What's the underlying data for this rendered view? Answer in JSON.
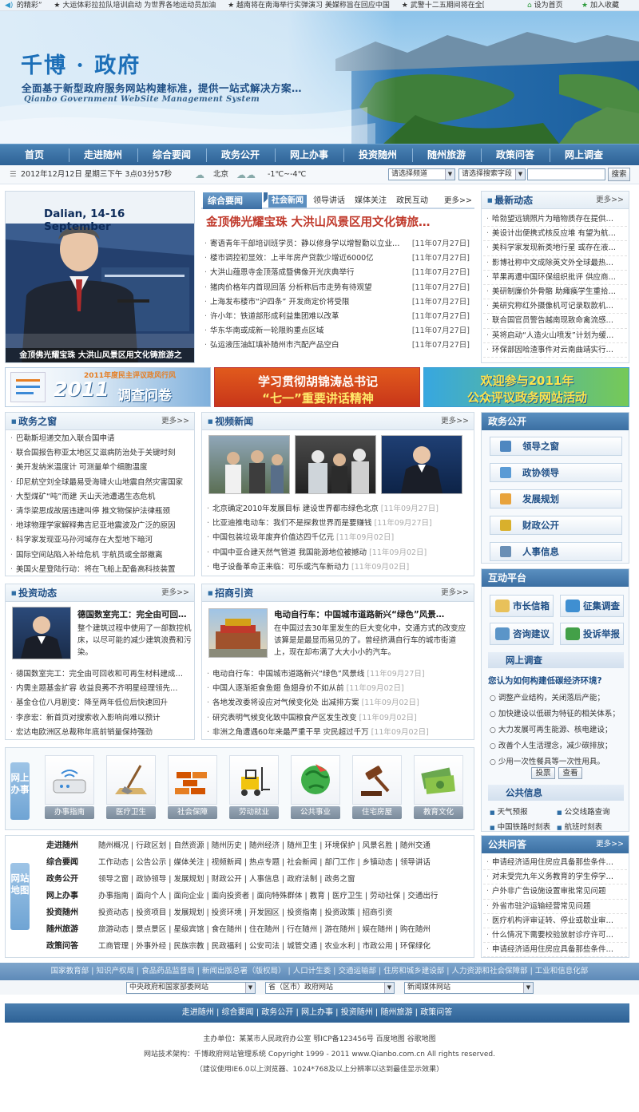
{
  "ticker": {
    "items": [
      "的精彩”",
      "★ 大运体彩拉拉队培训启动 为世界各地运动员加油",
      "★ 越南将在南海举行实弹演习 美媒称旨在回应中国",
      "★ 武警十二五期间将在全国"
    ],
    "home_label": "设为首页",
    "fav_label": "加入收藏"
  },
  "banner": {
    "title": "千博 · 政府",
    "slogan": "全面基于新型政府服务网站构建标准，提供一站式解决方案…",
    "english": "Qianbo Government WebSite Management System"
  },
  "nav": [
    "首页",
    "走进随州",
    "综合要闻",
    "政务公开",
    "网上办事",
    "投资随州",
    "随州旅游",
    "政策问答",
    "网上调查"
  ],
  "datebar": {
    "datetime": "2012年12月12日 星期三下午 3点03分57秒",
    "city": "北京",
    "temp": "-1℃~-4℃",
    "channel_select": "请选择频道",
    "field_select": "请选择搜索字段",
    "search_button": "搜索"
  },
  "photo": {
    "overlay_text": "Dalian, 14-16 September",
    "caption": "金顶佛光耀宝珠 大洪山风景区用文化铸旅游之"
  },
  "news": {
    "tabs": [
      "综合要闻",
      "社会新闻",
      "领导讲话",
      "媒体关注",
      "政民互动"
    ],
    "more": "更多>>",
    "headline": "金顶佛光耀宝珠 大洪山风景区用文化铸旅…",
    "items": [
      {
        "title": "寄语青年干部培训班学员：静以修身学以增智勤以立业…",
        "date": "[11年07月27日]"
      },
      {
        "title": "楼市调控初显效：上半年房产贷款少增近6000亿",
        "date": "[11年07月27日]"
      },
      {
        "title": "大洪山蕴恩寺金顶落成暨佛像开光庆典举行",
        "date": "[11年07月27日]"
      },
      {
        "title": "猪肉价格年内首现回落 分析称后市走势有待观望",
        "date": "[11年07月27日]"
      },
      {
        "title": "上海发布楼市“沪四条” 开发商定价将受限",
        "date": "[11年07月27日]"
      },
      {
        "title": "许小年：铁道部形成利益集团难以改革",
        "date": "[11年07月27日]"
      },
      {
        "title": "华东华南或成新一轮限购重点区域",
        "date": "[11年07月27日]"
      },
      {
        "title": "弘运液压油缸填补随州市汽配产品空白",
        "date": "[11年07月27日]"
      }
    ]
  },
  "latest": {
    "title": "最新动态",
    "more": "更多>>",
    "items": [
      "哈勃望远镜照片为暗物质存在提供…",
      "美设计出便携式核反应堆 有望为航…",
      "美科学家发现新类地行星 或存在液…",
      "影博社称中文成除英文外全球最热…",
      "苹果再遭中国环保组织批评 供应商…",
      "美研制廉价外骨骼 助瘫痪学生重拾…",
      "美研究称红外摄像机可记录取款机…",
      "联合国官员警告越南现致命禽流感…",
      "英将启动“人造火山喷发”计划为缓…",
      "环保部因哈渣事件对云南曲靖实行…"
    ]
  },
  "ad_banners": [
    {
      "tag": "2011年度民主评议政风行风",
      "year": "2011",
      "label": "调查问卷"
    },
    {
      "line1": "学习贯彻胡锦涛总书记",
      "line2": "“七一”重要讲话精神"
    },
    {
      "line1": "欢迎参与2011年",
      "line2": "公众评议政务网站活动"
    }
  ],
  "gov_window": {
    "title": "政务之窗",
    "more": "更多>>",
    "items": [
      "巴勒斯坦递交加入联合国申请",
      "联合国报告称亚太地区艾滋病防治处于关键时刻",
      "美开发纳米温度计 可测量单个细胞温度",
      "印尼航空刘全球最易受海啸火山地震自然灾害国家",
      "大型煤矿“吨”而建 天山天池遭遇生态危机",
      "清华梁思成故居违建叫停 推文物保护法律瓶颈",
      "地球物理学家解释弗吉尼亚地震波及广泛的原因",
      "科学家发现亚马孙河域存在大型地下暗河",
      "国际空间站陷入补给危机 宇航员或全部撤离",
      "美国火星登陆行动：将在飞船上配备高科技装置"
    ]
  },
  "video_news": {
    "title": "视频新闻",
    "more": "更多>>",
    "items": [
      {
        "title": "北京确定2010年发展目标 建设世界都市绿色北京",
        "date": "[11年09月27日]"
      },
      {
        "title": "比亚迪推电动车：我们不是探救世界而是要赚钱",
        "date": "[11年09月27日]"
      },
      {
        "title": "中国包装垃圾年废弃价值达四千亿元",
        "date": "[11年09月02日]"
      },
      {
        "title": "中国中亚合建天然气管道 我国能源地位被撼动",
        "date": "[11年09月02日]"
      },
      {
        "title": "电子设备革命正来临：可乐或汽车新动力",
        "date": "[11年09月02日]"
      }
    ]
  },
  "gov_open": {
    "title": "政务公开",
    "buttons": [
      "领导之窗",
      "政协领导",
      "发展规划",
      "财政公开",
      "人事信息"
    ]
  },
  "invest": {
    "title": "投资动态",
    "more": "更多>>",
    "feature_title": "德国数室完工：完全由可回…",
    "feature_text": "整个建筑过程中使用了一部数控机床，以尽可能的减少建筑浪费和污染。",
    "items": [
      "德国数室完工：完全由可回收和可再生材料建成…",
      "内需主题基金扩容 收益良莠不齐明星经理领先…",
      "基金仓位八月剧变：降至两年低位后快速回升",
      "李彦宏：新首页对搜索收入影响尚难以预计",
      "宏达电欧洲区总裁称年底前销量保持强劲"
    ]
  },
  "invite": {
    "title": "招商引资",
    "more": "更多>>",
    "feature_title": "电动自行车：中国城市道路新兴“绿色”风景…",
    "feature_text": "在中国过去30年里发生的巨大变化中，交通方式的改变应该算是是最显而易见的了。曾经挤满自行车的城市街道上，现在却布满了大大小小的汽车。",
    "items": [
      {
        "title": "电动自行车：中国城市道路新兴“绿色”风景线",
        "date": "[11年09月27日]"
      },
      {
        "title": "中国人逐渐拒食鱼翅 鱼翅身价不如从前",
        "date": "[11年09月02日]"
      },
      {
        "title": "各地发改委将设应对气候变化处 出减排方案",
        "date": "[11年09月02日]"
      },
      {
        "title": "研究表明气候变化致中国粮食产区发生改变",
        "date": "[11年09月02日]"
      },
      {
        "title": "非洲之角遭遇60年来最严重干旱 灾民超过千万",
        "date": "[11年09月02日]"
      }
    ]
  },
  "interact": {
    "title": "互动平台",
    "buttons": [
      "市长信箱",
      "征集调查",
      "咨询建议",
      "投诉举报"
    ]
  },
  "survey": {
    "title": "网上调查",
    "question": "您认为如何构建低碳经济环境?",
    "options": [
      "调整产业结构，关闭落后产能；",
      "加快建设以低碳为特征的相关体系；",
      "大力发展可再生能源、核电建设；",
      "改善个人生活理念，减少碳排放；",
      "少用一次性餐具等一次性用具。"
    ],
    "vote": "投票",
    "view": "查看"
  },
  "public_info": {
    "title": "公共信息",
    "items": [
      "天气预报",
      "公交线路查询",
      "中国铁路时刻表",
      "航班时刻表"
    ]
  },
  "services": {
    "side_label": "网上办事",
    "items": [
      "办事指南",
      "医疗卫生",
      "社会保障",
      "劳动就业",
      "公共事业",
      "住宅房屋",
      "教育文化"
    ]
  },
  "sitemap": {
    "side_label": "网站地图",
    "rows": [
      {
        "key": "走进随州",
        "value": "随州概况 | 行政区划 | 自然资源 | 随州历史 | 随州经济 | 随州卫生 | 环境保护 | 风景名胜 | 随州交通"
      },
      {
        "key": "综合要闻",
        "value": "工作动态 | 公告公示 | 媒体关注 | 视频新闻 | 热点专题 | 社会新闻 | 部门工作 | 乡镇动态 | 领导讲话"
      },
      {
        "key": "政务公开",
        "value": "领导之窗 | 政协领导 | 发展规划 | 财政公开 | 人事信息 | 政府法制 | 政务之窗"
      },
      {
        "key": "网上办事",
        "value": "办事指南 | 面向个人 | 面向企业 | 面向投资者 | 面向特殊群体 | 教育 | 医疗卫生 | 劳动社保 | 交通出行"
      },
      {
        "key": "投资随州",
        "value": "投资动态 | 投资项目 | 发展规划 | 投资环境 | 开发园区 | 投资指南 | 投资政策 | 招商引资"
      },
      {
        "key": "随州旅游",
        "value": "旅游动态 | 景点景区 | 星级宾馆 | 食在随州 | 住在随州 | 行在随州 | 游在随州 | 娱在随州 | 购在随州"
      },
      {
        "key": "政策问答",
        "value": "工商管理 | 外事外经 | 民族宗教 | 民政福利 | 公安司法 | 城管交通 | 农业水利 | 市政公用 | 环保绿化"
      }
    ]
  },
  "qa": {
    "title": "公共问答",
    "more": "更多>>",
    "items": [
      "申请经济适用住房应具备那些条件…",
      "对未受完九年义务教育的学生停学…",
      "户外非广告设施设置审批常见问题",
      "外省市驻沪运输经营常见问题",
      "医疗机构评审证转、停业或歇业审…",
      "什么情况下需要校验放射诊疗许可…",
      "申请经济适用住房应具备那些条件…"
    ]
  },
  "footer": {
    "links": [
      "国家教育部",
      "知识产权局",
      "食品药品监督局",
      "新闻出版总署（版权局）",
      "人口计生委",
      "交通运输部",
      "住房和城乡建设部",
      "人力资源和社会保障部",
      "工业和信息化部"
    ],
    "selects": [
      "中央政府和国家部委网站",
      "省（区市）政府网站",
      "新闻媒体网站"
    ],
    "nav": [
      "走进随州",
      "综合要闻",
      "政务公开",
      "网上办事",
      "投资随州",
      "随州旅游",
      "政策问答"
    ],
    "line1": "主办单位：某某市人民政府办公室 鄂ICP备123456号 百度地图 谷歌地图",
    "line2": "网站技术架构：千博政府网站管理系统 Copyright 1999 - 2011 www.Qianbo.com.cn All rights reserved.",
    "line3": "（建议使用IE6.0以上浏览器、1024*768及以上分辨率以达到最佳显示效果）"
  },
  "colors": {
    "primary": "#2d6195",
    "accent_red": "#c0392b",
    "link_blue": "#1f4f86"
  }
}
